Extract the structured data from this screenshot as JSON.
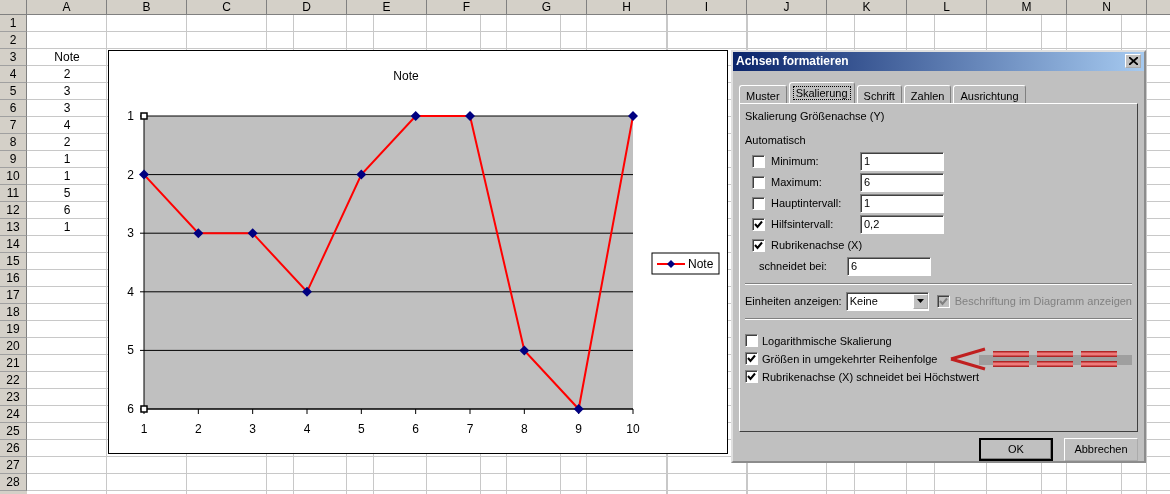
{
  "sheet": {
    "columns": [
      "A",
      "B",
      "C",
      "D",
      "E",
      "F",
      "G",
      "H",
      "I",
      "J",
      "K",
      "L",
      "M",
      "N"
    ],
    "rows": [
      {
        "header": "1"
      },
      {
        "header": "2"
      },
      {
        "header": "3",
        "a": "Note"
      },
      {
        "header": "4",
        "a": "2"
      },
      {
        "header": "5",
        "a": "3"
      },
      {
        "header": "6",
        "a": "3"
      },
      {
        "header": "7",
        "a": "4"
      },
      {
        "header": "8",
        "a": "2"
      },
      {
        "header": "9",
        "a": "1"
      },
      {
        "header": "10",
        "a": "1"
      },
      {
        "header": "11",
        "a": "5"
      },
      {
        "header": "12",
        "a": "6"
      },
      {
        "header": "13",
        "a": "1"
      },
      {
        "header": "14"
      },
      {
        "header": "15"
      },
      {
        "header": "16"
      },
      {
        "header": "17"
      },
      {
        "header": "18"
      },
      {
        "header": "19"
      },
      {
        "header": "20"
      },
      {
        "header": "21"
      },
      {
        "header": "22"
      },
      {
        "header": "23"
      },
      {
        "header": "24"
      },
      {
        "header": "25"
      },
      {
        "header": "26"
      },
      {
        "header": "27"
      },
      {
        "header": "28"
      }
    ]
  },
  "chart": {
    "chart_data": {
      "type": "line",
      "title": "Note",
      "categories": [
        "1",
        "2",
        "3",
        "4",
        "5",
        "6",
        "7",
        "8",
        "9",
        "10"
      ],
      "series": [
        {
          "name": "Note",
          "color": "#ff0000",
          "marker": "diamond",
          "values": [
            2,
            3,
            3,
            4,
            2,
            1,
            1,
            5,
            6,
            1
          ]
        }
      ],
      "ylim": [
        6,
        1
      ],
      "yticks": [
        1,
        2,
        3,
        4,
        5,
        6
      ],
      "grid": true
    }
  },
  "dialog": {
    "title": "Achsen formatieren",
    "tabs": [
      {
        "label": "Muster",
        "selected": false
      },
      {
        "label": "Skalierung",
        "selected": true
      },
      {
        "label": "Schrift",
        "selected": false
      },
      {
        "label": "Zahlen",
        "selected": false
      },
      {
        "label": "Ausrichtung",
        "selected": false
      }
    ],
    "heading": "Skalierung Größenachse (Y)",
    "auto_label": "Automatisch",
    "auto_rows": [
      {
        "label": "Minimum:",
        "checked": false,
        "value": "1"
      },
      {
        "label": "Maximum:",
        "checked": false,
        "value": "6"
      },
      {
        "label": "Hauptintervall:",
        "checked": false,
        "value": "1"
      },
      {
        "label": "Hilfsintervall:",
        "checked": true,
        "value": "0,2"
      }
    ],
    "crosses": {
      "label": "Rubrikenachse (X)",
      "checked": true,
      "sub_label": "schneidet bei:",
      "value": "6"
    },
    "units": {
      "label": "Einheiten anzeigen:",
      "value": "Keine",
      "show_label": {
        "label": "Beschriftung im Diagramm anzeigen",
        "checked": true,
        "disabled": true
      }
    },
    "options": [
      {
        "label": "Logarithmische Skalierung",
        "checked": false,
        "highlighted": false
      },
      {
        "label": "Größen in umgekehrter Reihenfolge",
        "checked": true,
        "highlighted": true
      },
      {
        "label": "Rubrikenachse (X) schneidet bei Höchstwert",
        "checked": true,
        "highlighted": false
      }
    ],
    "buttons": [
      {
        "label": "OK",
        "default": true
      },
      {
        "label": "Abbrechen",
        "default": false
      }
    ]
  }
}
